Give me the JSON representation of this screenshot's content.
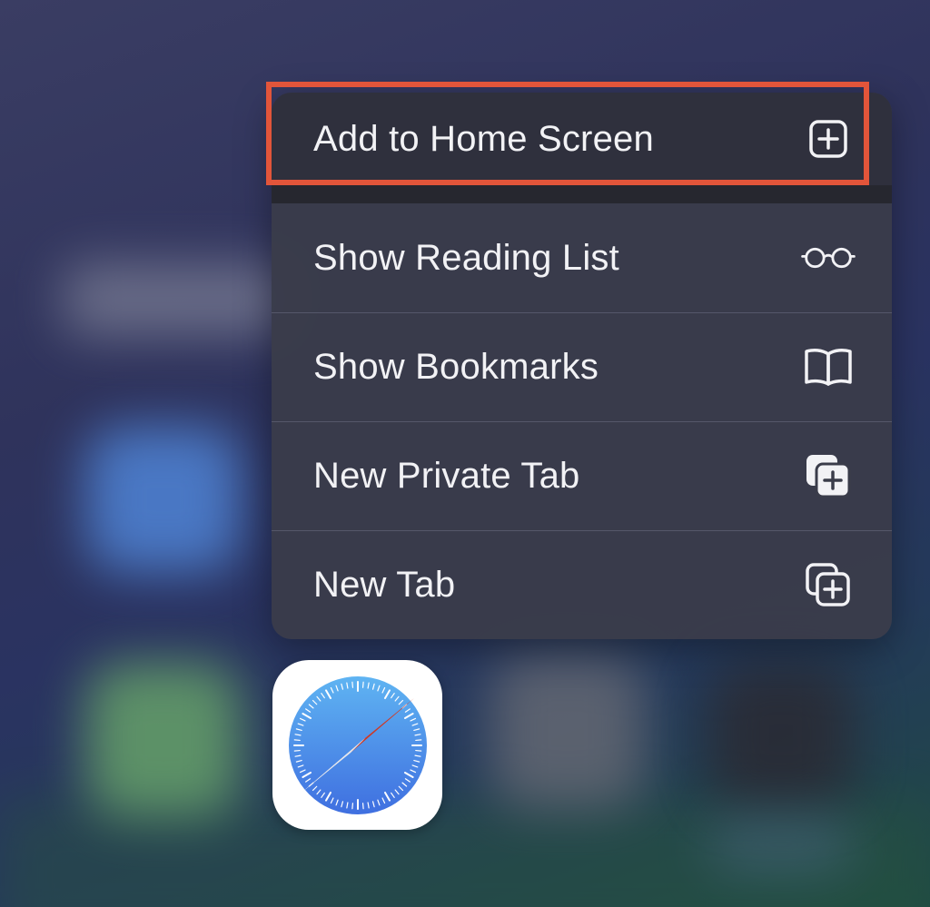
{
  "menu": {
    "items": [
      {
        "label": "Add to Home Screen",
        "icon": "add-square-icon"
      },
      {
        "label": "Show Reading List",
        "icon": "glasses-icon"
      },
      {
        "label": "Show Bookmarks",
        "icon": "book-icon"
      },
      {
        "label": "New Private Tab",
        "icon": "private-tab-icon"
      },
      {
        "label": "New Tab",
        "icon": "new-tab-icon"
      }
    ],
    "highlighted_item": "Add to Home Screen"
  },
  "app": {
    "name_icon": "safari-compass-icon"
  },
  "colors": {
    "highlight_border": "#e2553a",
    "menu_background": "#3a3c4a",
    "text": "#f2f2f5",
    "compass_blue": "#4a86e8",
    "needle_red": "#e8503a"
  }
}
